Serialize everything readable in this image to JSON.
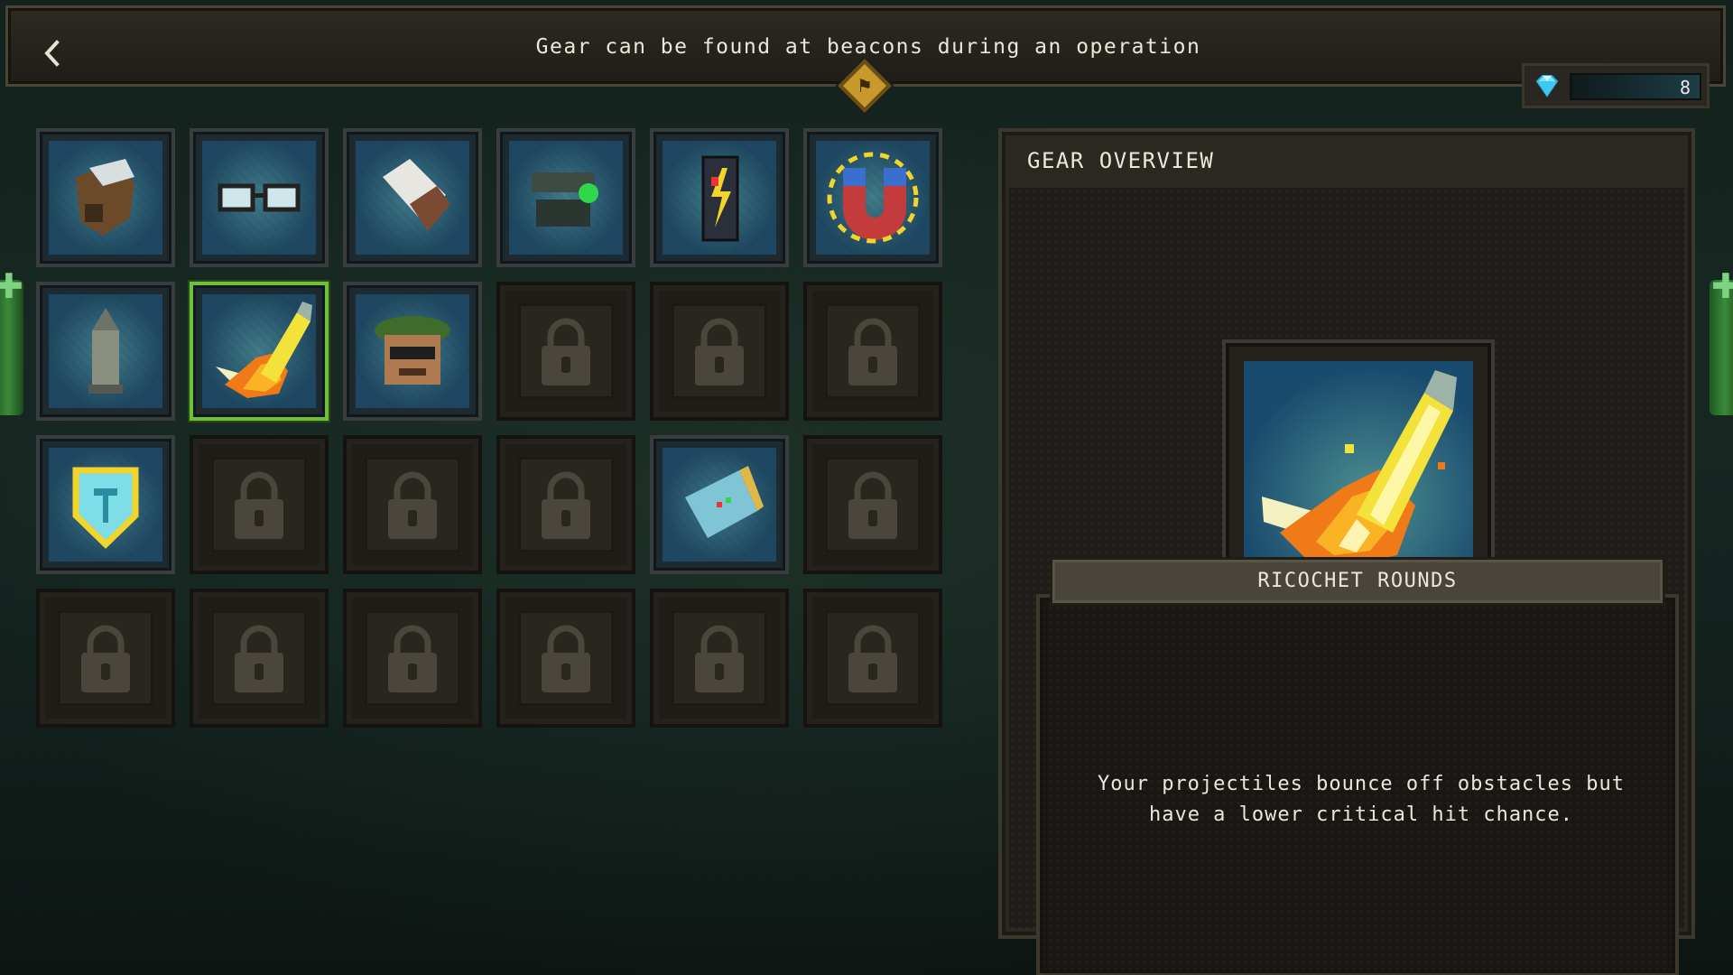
{
  "header": {
    "back_icon": "chevron-left-icon",
    "hint": "Gear can be found at beacons during an operation",
    "beacon_icon": "beacon-diamond-icon"
  },
  "currency": {
    "icon": "gem-icon",
    "value": "8"
  },
  "grid": {
    "rows": 4,
    "columns": 6,
    "slots": [
      {
        "state": "unlocked",
        "icon": "gauntlet-gear-icon"
      },
      {
        "state": "unlocked",
        "icon": "glasses-gear-icon"
      },
      {
        "state": "unlocked",
        "icon": "bandage-gear-icon"
      },
      {
        "state": "unlocked",
        "icon": "scope-gear-icon"
      },
      {
        "state": "unlocked",
        "icon": "energy-drink-gear-icon"
      },
      {
        "state": "unlocked",
        "icon": "magnet-gear-icon"
      },
      {
        "state": "unlocked",
        "icon": "shell-gear-icon"
      },
      {
        "state": "unlocked",
        "icon": "ricochet-rounds-gear-icon",
        "selected": true
      },
      {
        "state": "unlocked",
        "icon": "beret-soldier-gear-icon"
      },
      {
        "state": "locked",
        "icon": "lock-icon"
      },
      {
        "state": "locked",
        "icon": "lock-icon"
      },
      {
        "state": "locked",
        "icon": "lock-icon"
      },
      {
        "state": "unlocked",
        "icon": "shield-gear-icon"
      },
      {
        "state": "locked",
        "icon": "lock-icon"
      },
      {
        "state": "locked",
        "icon": "lock-icon"
      },
      {
        "state": "locked",
        "icon": "lock-icon"
      },
      {
        "state": "unlocked",
        "icon": "map-gear-icon"
      },
      {
        "state": "locked",
        "icon": "lock-icon"
      },
      {
        "state": "locked",
        "icon": "lock-icon"
      },
      {
        "state": "locked",
        "icon": "lock-icon"
      },
      {
        "state": "locked",
        "icon": "lock-icon"
      },
      {
        "state": "locked",
        "icon": "lock-icon"
      },
      {
        "state": "locked",
        "icon": "lock-icon"
      },
      {
        "state": "locked",
        "icon": "lock-icon"
      }
    ]
  },
  "overview": {
    "title": "GEAR OVERVIEW",
    "item_name": "RICOCHET ROUNDS",
    "item_icon": "ricochet-rounds-gear-icon",
    "description": "Your projectiles bounce off obstacles but have a lower critical hit chance."
  },
  "colors": {
    "selected_border": "#6fbf3a",
    "panel_bg": "#2b2822",
    "background": "#14211d"
  }
}
